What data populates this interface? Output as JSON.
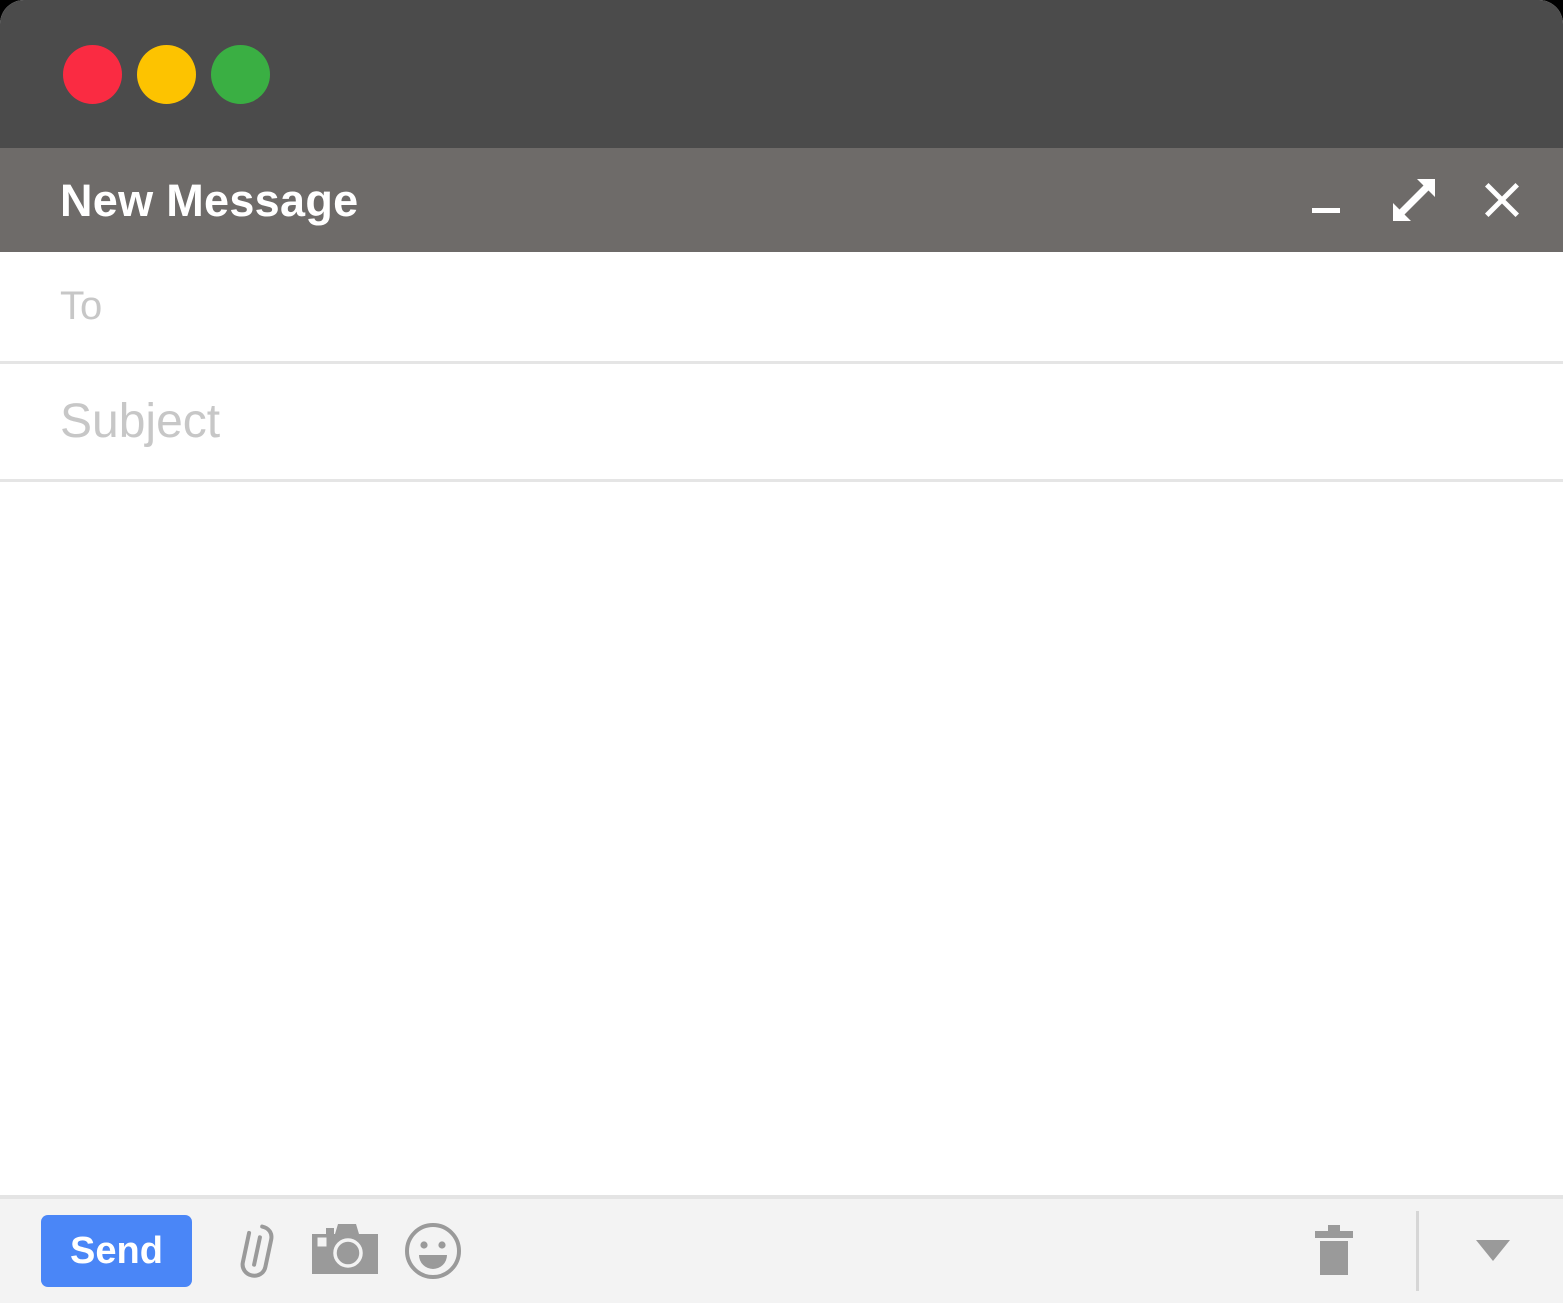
{
  "window": {
    "os_controls": [
      {
        "name": "close",
        "color": "#fa2b42"
      },
      {
        "name": "minimize",
        "color": "#fdc300"
      },
      {
        "name": "maximize",
        "color": "#3aaf43"
      }
    ]
  },
  "header": {
    "title": "New Message",
    "background": "#6e6b69",
    "controls": [
      {
        "name": "minimize-window",
        "icon": "minimize-icon"
      },
      {
        "name": "expand-window",
        "icon": "expand-icon"
      },
      {
        "name": "close-window",
        "icon": "close-icon"
      }
    ]
  },
  "fields": {
    "to": {
      "label": "To",
      "placeholder": "To",
      "value": ""
    },
    "subject": {
      "label": "Subject",
      "placeholder": "Subject",
      "value": ""
    },
    "body": {
      "placeholder": "",
      "value": ""
    }
  },
  "toolbar": {
    "send_label": "Send",
    "send_color": "#4a86f7",
    "icon_color": "#9a9a9a",
    "attach_label": "Attach files",
    "photo_label": "Insert photo",
    "emoji_label": "Insert emoji",
    "discard_label": "Discard draft",
    "more_label": "More options"
  }
}
